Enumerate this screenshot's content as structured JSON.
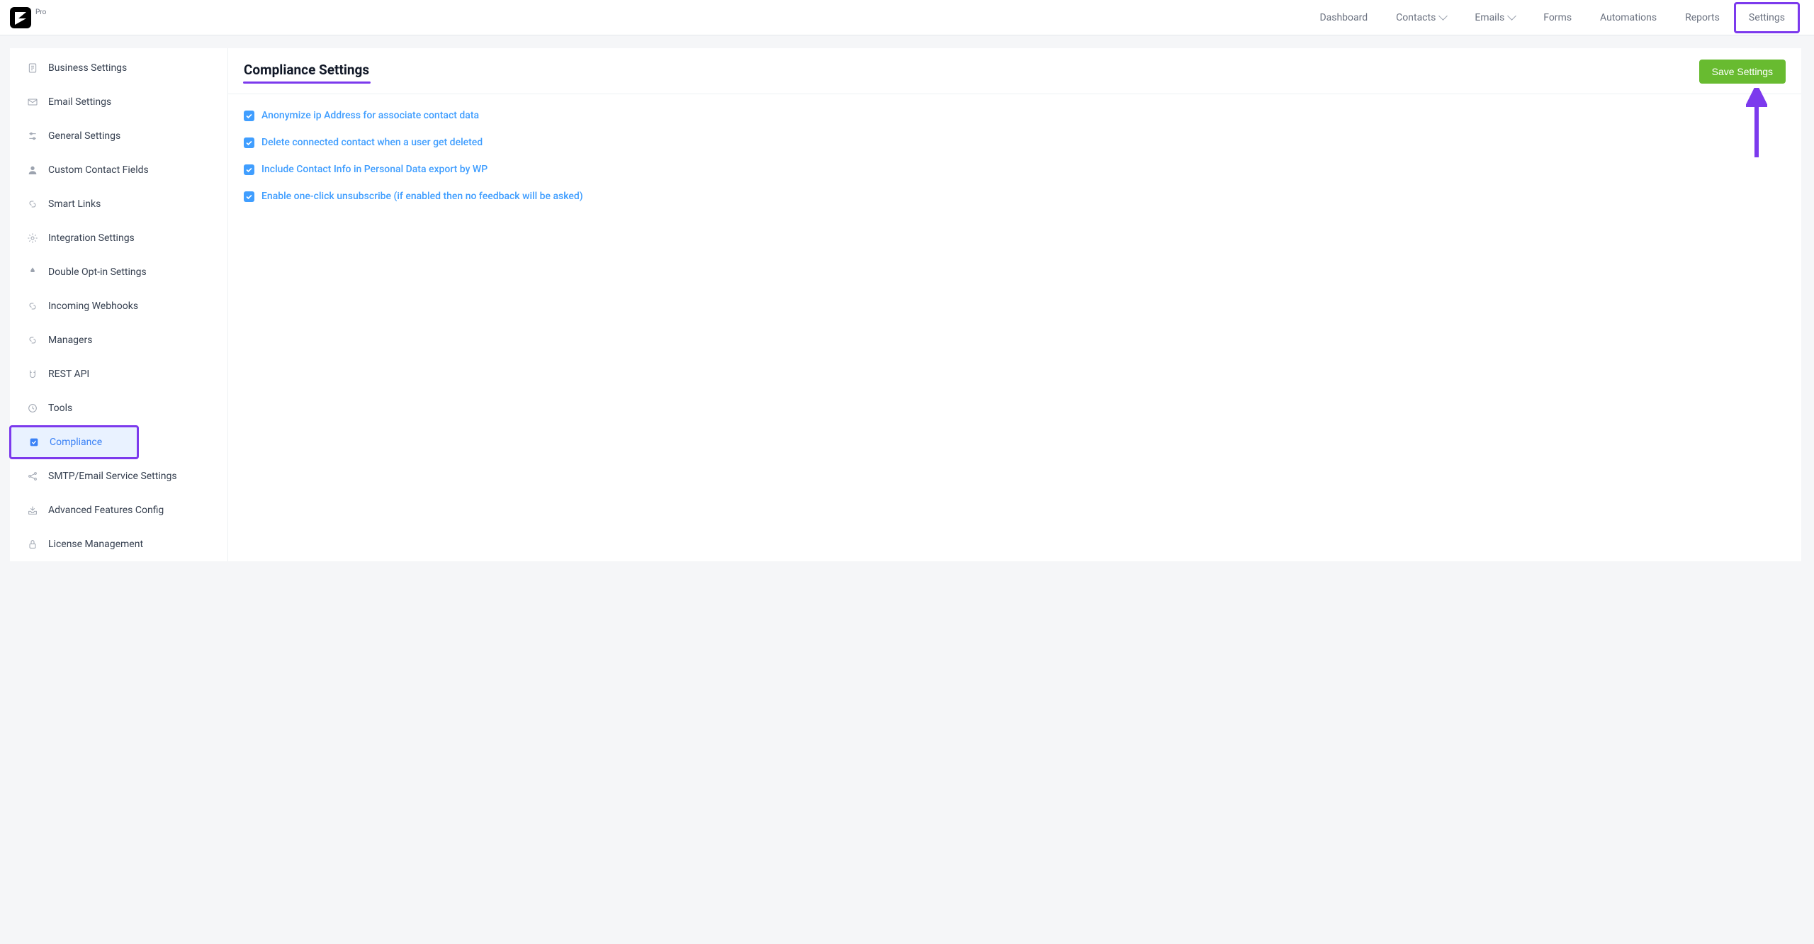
{
  "brand": {
    "pro_label": "Pro"
  },
  "topnav": {
    "dashboard": "Dashboard",
    "contacts": "Contacts",
    "emails": "Emails",
    "forms": "Forms",
    "automations": "Automations",
    "reports": "Reports",
    "settings": "Settings"
  },
  "sidebar": {
    "business": "Business Settings",
    "email": "Email Settings",
    "general": "General Settings",
    "custom_fields": "Custom Contact Fields",
    "smart_links": "Smart Links",
    "integration": "Integration Settings",
    "double_optin": "Double Opt-in Settings",
    "incoming_webhooks": "Incoming Webhooks",
    "managers": "Managers",
    "rest_api": "REST API",
    "tools": "Tools",
    "compliance": "Compliance",
    "smtp": "SMTP/Email Service Settings",
    "advanced": "Advanced Features Config",
    "license": "License Management"
  },
  "page": {
    "title": "Compliance Settings",
    "save_label": "Save Settings"
  },
  "options": {
    "anonymize_ip": "Anonymize ip Address for associate contact data",
    "delete_contact": "Delete connected contact when a user get deleted",
    "include_export": "Include Contact Info in Personal Data export by WP",
    "one_click_unsub": "Enable one-click unsubscribe (if enabled then no feedback will be asked)"
  },
  "annotations": {
    "settings_highlight_color": "#7c3aed",
    "compliance_highlight_color": "#7c3aed",
    "arrow_color": "#7c3aed"
  }
}
